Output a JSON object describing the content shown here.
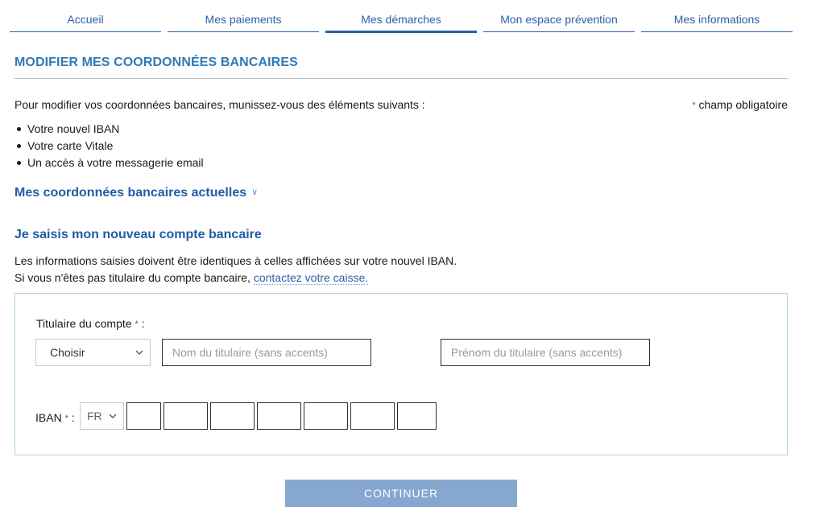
{
  "nav": {
    "tabs": [
      {
        "label": "Accueil",
        "active": false
      },
      {
        "label": "Mes paiements",
        "active": false
      },
      {
        "label": "Mes démarches",
        "active": true
      },
      {
        "label": "Mon espace prévention",
        "active": false
      },
      {
        "label": "Mes informations",
        "active": false
      }
    ]
  },
  "page": {
    "title": "MODIFIER MES COORDONNÉES BANCAIRES",
    "intro": "Pour modifier vos coordonnées bancaires, munissez-vous des éléments suivants :",
    "required_marker": "*",
    "required_note": "champ obligatoire",
    "requirements": [
      "Votre nouvel IBAN",
      "Votre carte Vitale",
      "Un accès à votre messagerie email"
    ],
    "current_section": {
      "label": "Mes coordonnées bancaires actuelles",
      "icon": "double-chevron-down-icon"
    },
    "new_section": {
      "heading": "Je saisis mon nouveau compte bancaire",
      "info_line1": "Les informations saisies doivent être identiques à celles affichées sur votre nouvel IBAN.",
      "info_line2_prefix": "Si vous n'êtes pas titulaire du compte bancaire, ",
      "info_line2_link": "contactez votre caisse."
    }
  },
  "form": {
    "holder": {
      "label": "Titulaire du compte",
      "suffix": ":",
      "civility_select_value": "Choisir",
      "last_name_placeholder": "Nom du titulaire (sans accents)",
      "last_name_value": "",
      "first_name_placeholder": "Prénom du titulaire (sans accents)",
      "first_name_value": ""
    },
    "iban": {
      "label": "IBAN",
      "suffix": ":",
      "country_value": "FR",
      "segments": [
        "",
        "",
        "",
        "",
        "",
        "",
        ""
      ]
    }
  },
  "actions": {
    "continue_label": "CONTINUER"
  },
  "colors": {
    "accent": "#2b5fa8",
    "title": "#2f7ab8",
    "box_border": "#a8d5de",
    "button_disabled": "#86a7cf"
  }
}
